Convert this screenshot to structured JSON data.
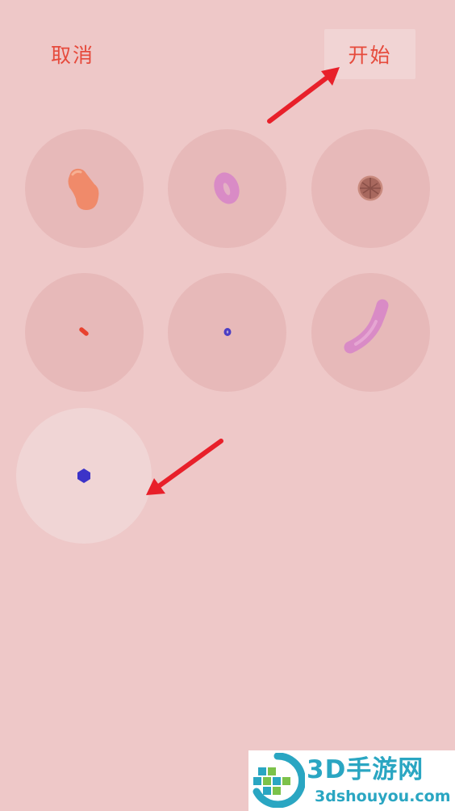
{
  "header": {
    "cancel_label": "取消",
    "start_label": "开始"
  },
  "cells": [
    {
      "item": "orange-peanut-shape",
      "color": "#f08a6a",
      "selected": false
    },
    {
      "item": "pink-donut-shape",
      "color": "#d98bc6",
      "selected": false
    },
    {
      "item": "brown-spiky-ball-shape",
      "color": "#a8685e",
      "selected": false
    },
    {
      "item": "small-red-dash-shape",
      "color": "#e8412e",
      "selected": false
    },
    {
      "item": "tiny-blue-ring-shape",
      "color": "#4b3ec4",
      "selected": false
    },
    {
      "item": "pink-curved-rod-shape",
      "color": "#d98bc6",
      "selected": false
    },
    {
      "item": "blue-hexagon-dot-shape",
      "color": "#3c33c8",
      "selected": true
    }
  ],
  "colors": {
    "background": "#eec8c8",
    "accent_text": "#e64a3c",
    "cell_fill": "#e7b9b9",
    "selected_fill": "#f0d5d5",
    "arrow": "#e8202a",
    "watermark_text": "#2aa6c2"
  },
  "watermark": {
    "name": "3D手游网",
    "url": "3dshouyou.com"
  }
}
